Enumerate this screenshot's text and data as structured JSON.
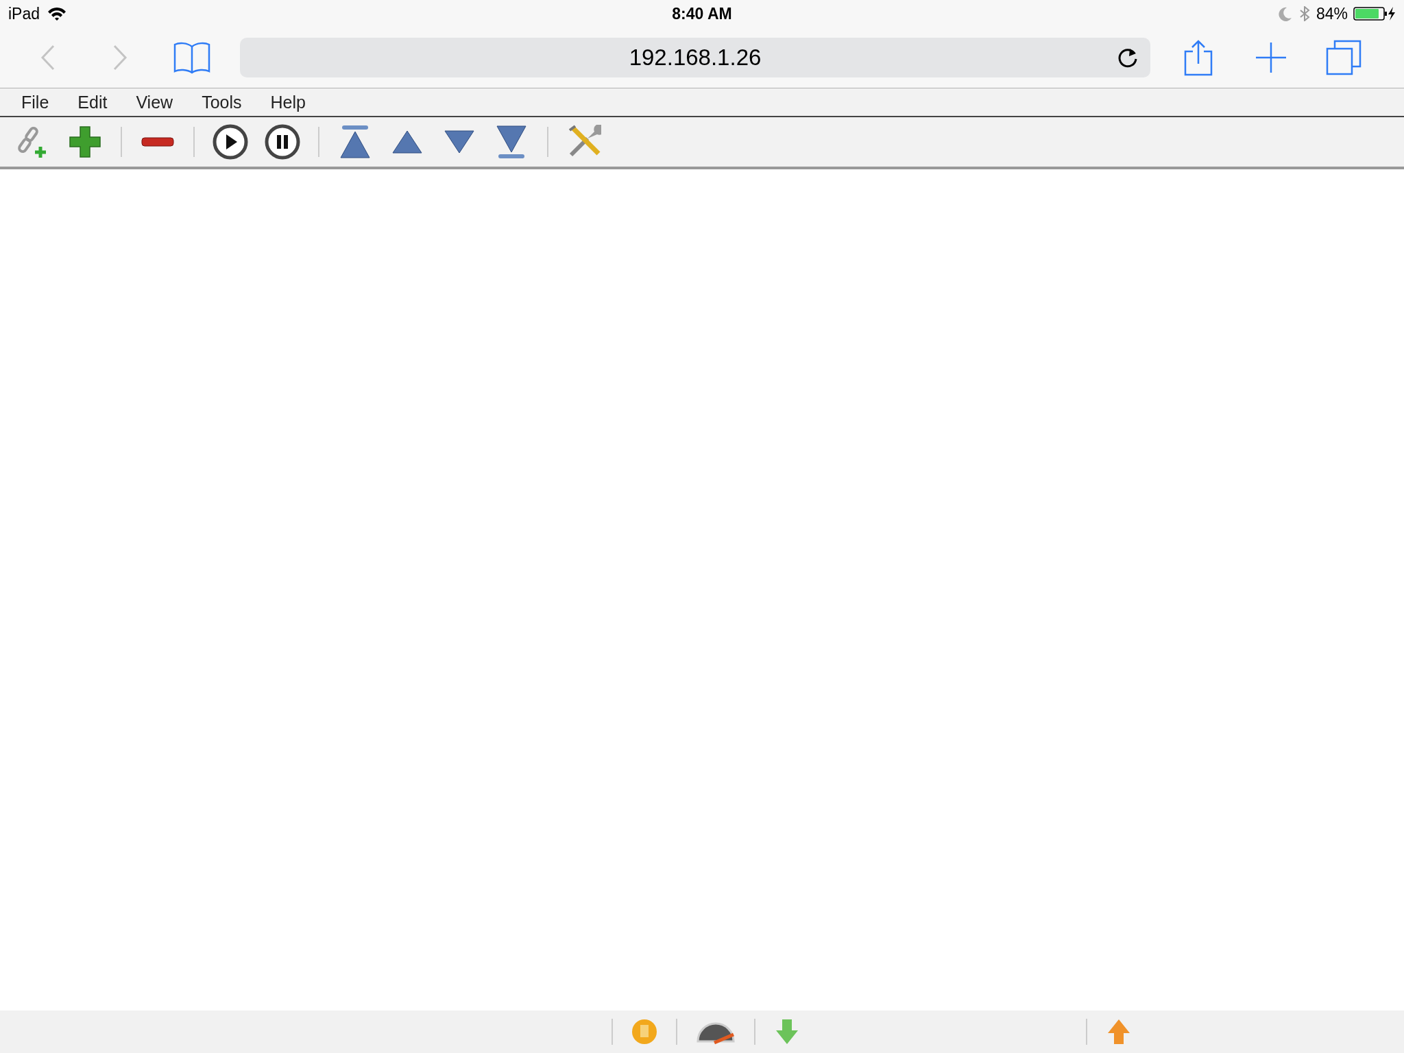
{
  "status_bar": {
    "device": "iPad",
    "time": "8:40 AM",
    "battery": "84%"
  },
  "browser": {
    "back": {
      "disabled": true
    },
    "forward": {
      "disabled": true
    },
    "url": "192.168.1.26"
  },
  "menu": [
    "File",
    "Edit",
    "View",
    "Tools",
    "Help"
  ]
}
